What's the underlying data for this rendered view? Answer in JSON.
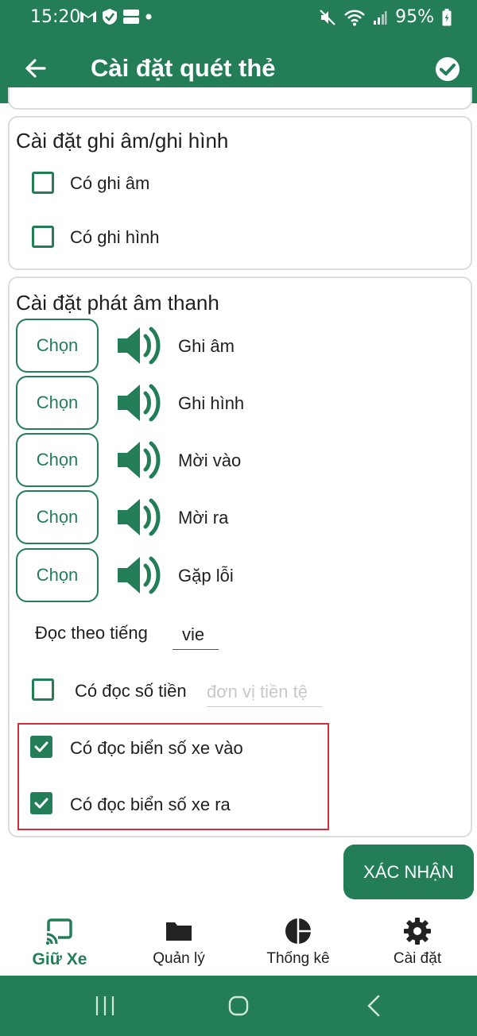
{
  "status_bar": {
    "time": "15:20",
    "battery": "95%"
  },
  "app_bar": {
    "title": "Cài đặt quét thẻ"
  },
  "recording_section": {
    "title": "Cài đặt ghi âm/ghi hình",
    "options": [
      {
        "label": "Có ghi âm",
        "checked": false
      },
      {
        "label": "Có ghi hình",
        "checked": false
      }
    ]
  },
  "sound_section": {
    "title": "Cài đặt phát âm thanh",
    "choose_label": "Chọn",
    "sounds": [
      {
        "label": "Ghi âm"
      },
      {
        "label": "Ghi hình"
      },
      {
        "label": "Mời vào"
      },
      {
        "label": "Mời ra"
      },
      {
        "label": "Gặp lỗi"
      }
    ],
    "language_label": "Đọc theo tiếng",
    "language_value": "vie",
    "read_money_label": "Có đọc số tiền",
    "read_money_checked": false,
    "currency_placeholder": "đơn vị tiền tệ",
    "read_plate_in_label": "Có đọc biển số xe vào",
    "read_plate_in_checked": true,
    "read_plate_out_label": "Có đọc biển số xe ra",
    "read_plate_out_checked": true
  },
  "confirm_button": "XÁC NHẬN",
  "bottom_nav": {
    "items": [
      {
        "label": "Giữ Xe",
        "icon": "cast-icon",
        "active": true
      },
      {
        "label": "Quản lý",
        "icon": "folder-icon",
        "active": false
      },
      {
        "label": "Thống kê",
        "icon": "pie-chart-icon",
        "active": false
      },
      {
        "label": "Cài đặt",
        "icon": "gear-icon",
        "active": false
      }
    ]
  },
  "colors": {
    "primary": "#237e57",
    "highlight": "#d32f3f"
  }
}
